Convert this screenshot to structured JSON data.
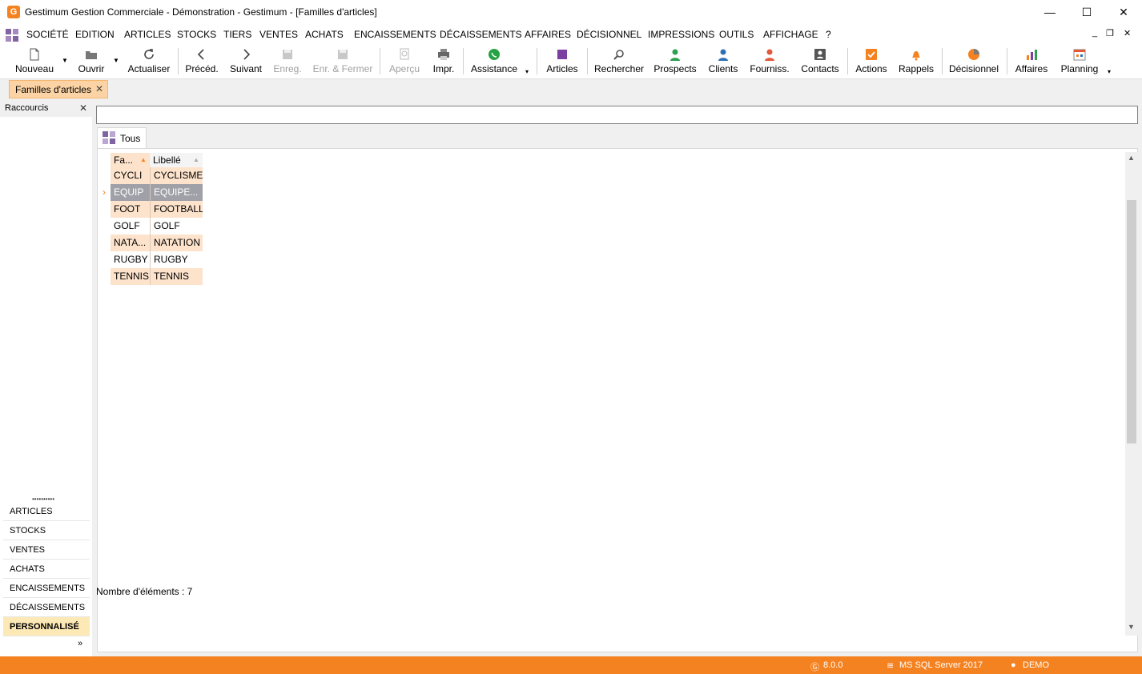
{
  "window": {
    "title": "Gestimum Gestion Commerciale - Démonstration - Gestimum - [Familles d'articles]",
    "app_logo_letter": "G",
    "minimize": "—",
    "maximize": "☐",
    "close": "✕"
  },
  "menu": {
    "items": [
      "SOCIÉTÉ",
      "EDITION",
      "ARTICLES",
      "STOCKS",
      "TIERS",
      "VENTES",
      "ACHATS",
      "ENCAISSEMENTS",
      "DÉCAISSEMENTS",
      "AFFAIRES",
      "DÉCISIONNEL",
      "IMPRESSIONS",
      "OUTILS",
      "AFFICHAGE",
      "?"
    ],
    "mdi_minimize": "_",
    "mdi_restore": "❐",
    "mdi_close": "✕"
  },
  "toolbar": {
    "nouveau": "Nouveau",
    "ouvrir": "Ouvrir",
    "actualiser": "Actualiser",
    "preced": "Précéd.",
    "suivant": "Suivant",
    "enreg": "Enreg.",
    "enr_fermer": "Enr. & Fermer",
    "apercu": "Aperçu",
    "impr": "Impr.",
    "assistance": "Assistance",
    "articles": "Articles",
    "rechercher": "Rechercher",
    "prospects": "Prospects",
    "clients": "Clients",
    "fourniss": "Fourniss.",
    "contacts": "Contacts",
    "actions": "Actions",
    "rappels": "Rappels",
    "decisionnel": "Décisionnel",
    "affaires": "Affaires",
    "planning": "Planning"
  },
  "doc_tab": {
    "label": "Familles d'articles",
    "close": "✕"
  },
  "left_panel": {
    "header": "Raccourcis",
    "close": "✕",
    "grip": "••••••••••",
    "nav": [
      "ARTICLES",
      "STOCKS",
      "VENTES",
      "ACHATS",
      "ENCAISSEMENTS",
      "DÉCAISSEMENTS",
      "PERSONNALISÉ"
    ],
    "more": "»"
  },
  "main": {
    "search_value": "",
    "tab_label": "Tous",
    "grid": {
      "columns": [
        "Fa...",
        "Libellé"
      ],
      "rows": [
        {
          "code": "CYCLI",
          "libelle": "CYCLISME"
        },
        {
          "code": "EQUIP",
          "libelle": "EQUIPE..."
        },
        {
          "code": "FOOT",
          "libelle": "FOOTBALL"
        },
        {
          "code": "GOLF",
          "libelle": "GOLF"
        },
        {
          "code": "NATA...",
          "libelle": "NATATION"
        },
        {
          "code": "RUGBY",
          "libelle": "RUGBY"
        },
        {
          "code": "TENNIS",
          "libelle": "TENNIS"
        }
      ],
      "selected_row_index": 1,
      "row_indicator": "›"
    },
    "count_text": "Nombre d'éléments : 7"
  },
  "statusbar": {
    "version": "8.0.0",
    "database": "MS SQL Server 2017",
    "user": "DEMO"
  },
  "colors": {
    "accent_orange": "#f58220",
    "row_orange": "#fde3cc",
    "selected_row": "#a0a0a8",
    "active_nav": "#fde9b6"
  }
}
